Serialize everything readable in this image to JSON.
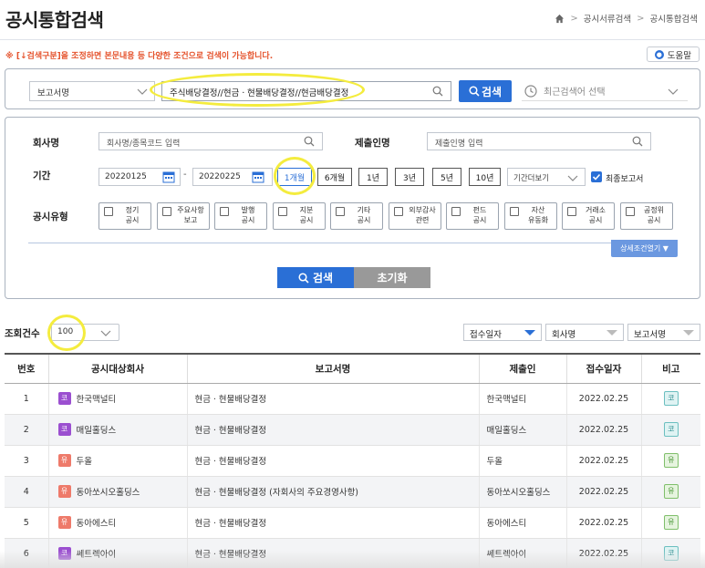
{
  "header": {
    "title": "공시통합검색",
    "breadcrumb": [
      "공시서류검색",
      "공시통합검색"
    ]
  },
  "notice": "※ [↓검색구분]을 조정하면 본문내용 등 다양한 조건으로 검색이 가능합니다.",
  "help_label": "도움말",
  "search": {
    "scope_value": "보고서명",
    "query_value": "주식배당결정//현금ㆍ현물배당결정//현금배당결정",
    "button_label": "검색",
    "recent_placeholder": "최근검색어 선택"
  },
  "filters": {
    "company_label": "회사명",
    "company_placeholder": "회사명/종목코드 입력",
    "submitter_label": "제출인명",
    "submitter_placeholder": "제출인명 입력",
    "period_label": "기간",
    "date_from": "20220125",
    "date_to": "20220225",
    "date_sep": "-",
    "periods": [
      "1개월",
      "6개월",
      "1년",
      "3년",
      "5년",
      "10년"
    ],
    "period_more": "기간더보기",
    "final_report_label": "최종보고서",
    "type_label": "공시유형",
    "types": [
      [
        "정기",
        "공시"
      ],
      [
        "주요사항",
        "보고"
      ],
      [
        "발행",
        "공시"
      ],
      [
        "지분",
        "공시"
      ],
      [
        "기타",
        "공시"
      ],
      [
        "외부감사",
        "관련"
      ],
      [
        "펀드",
        "공시"
      ],
      [
        "자산",
        "유동화"
      ],
      [
        "거래소",
        "공시"
      ],
      [
        "공정위",
        "공시"
      ]
    ],
    "detail_toggle": "상세조건열기 ▼",
    "search_button": "검색",
    "reset_button": "초기화"
  },
  "results": {
    "count_label": "조회건수",
    "count_value": "100",
    "sort": [
      "접수일자",
      "회사명",
      "보고서명"
    ],
    "columns": [
      "번호",
      "공시대상회사",
      "보고서명",
      "제출인",
      "접수일자",
      "비고"
    ],
    "rows": [
      {
        "no": "1",
        "badge": "코",
        "market": "kos",
        "company": "한국맥널티",
        "report": "현금ㆍ현물배당결정",
        "submitter": "한국맥널티",
        "date": "2022.02.25",
        "note": "코"
      },
      {
        "no": "2",
        "badge": "코",
        "market": "kos",
        "company": "매일홀딩스",
        "report": "현금ㆍ현물배당결정",
        "submitter": "매일홀딩스",
        "date": "2022.02.25",
        "note": "코"
      },
      {
        "no": "3",
        "badge": "유",
        "market": "yu",
        "company": "두올",
        "report": "현금ㆍ현물배당결정",
        "submitter": "두올",
        "date": "2022.02.25",
        "note": "유"
      },
      {
        "no": "4",
        "badge": "유",
        "market": "yu",
        "company": "동아쏘시오홀딩스",
        "report": "현금ㆍ현물배당결정 (자회사의 주요경영사항)",
        "submitter": "동아쏘시오홀딩스",
        "date": "2022.02.25",
        "note": "유"
      },
      {
        "no": "5",
        "badge": "유",
        "market": "yu",
        "company": "동아에스티",
        "report": "현금ㆍ현물배당결정",
        "submitter": "동아에스티",
        "date": "2022.02.25",
        "note": "유"
      },
      {
        "no": "6",
        "badge": "코",
        "market": "kos",
        "company": "쎄트렉아이",
        "report": "현금ㆍ현물배당결정",
        "submitter": "쎄트렉아이",
        "date": "2022.02.25",
        "note": "코"
      }
    ]
  },
  "colors": {
    "primary": "#2a6fd6",
    "notice": "#e5532d",
    "highlight": "#f4ec3e",
    "kosdaq_badge": "#9b4fd0",
    "kospi_badge": "#ee7a6a"
  }
}
